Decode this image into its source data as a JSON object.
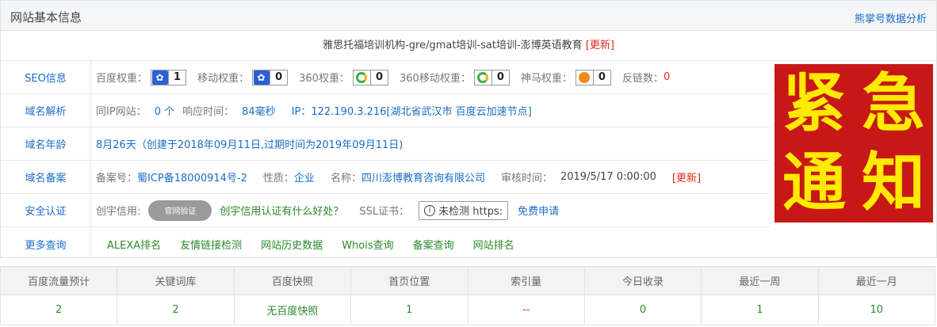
{
  "header": {
    "title": "网站基本信息",
    "link": "熊掌号数据分析"
  },
  "site": {
    "name": "雅思托福培训机构-gre/gmat培训-sat培训-澎博英语教育",
    "update": "[更新]"
  },
  "seo": {
    "label": "SEO信息",
    "baidu_label": "百度权重：",
    "baidu_value": "1",
    "mobile_label": "移动权重：",
    "mobile_value": "0",
    "s360_label": "360权重：",
    "s360_value": "0",
    "s360m_label": "360移动权重：",
    "s360m_value": "0",
    "shenma_label": "神马权重：",
    "shenma_value": "0",
    "backlink_label": "反链数：",
    "backlink_value": "0"
  },
  "dns": {
    "label": "域名解析",
    "sameip_label": "同IP网站：",
    "sameip_value": "0 个",
    "resp_label": "响应时间：",
    "resp_value": "84毫秒",
    "ip_label": "IP：",
    "ip_value": "122.190.3.216[湖北省武汉市 百度云加速节点]"
  },
  "age": {
    "label": "域名年龄",
    "value": "8月26天（创建于2018年09月11日,过期时间为2019年09月11日)"
  },
  "icp": {
    "label": "域名备案",
    "no_label": "备案号：",
    "no_value": "蜀ICP备18000914号-2",
    "type_label": "性质：",
    "type_value": "企业",
    "name_label": "名称：",
    "name_value": "四川澎博教育咨询有限公司",
    "time_label": "审核时间：",
    "time_value": "2019/5/17 0:00:00",
    "update": "[更新]"
  },
  "security": {
    "label": "安全认证",
    "credit_label": "创宇信用:",
    "seal_text": "官网验证",
    "credit_link": "创宇信用认证有什么好处？",
    "ssl_label": "SSL证书：",
    "ssl_value": "未检测 https:",
    "apply": "免费申请"
  },
  "more": {
    "label": "更多查询",
    "links": [
      "ALEXA排名",
      "友情链接检测",
      "网站历史数据",
      "Whois查询",
      "备案查询",
      "网站排名"
    ]
  },
  "banner": {
    "chars": [
      "紧",
      "急",
      "通",
      "知"
    ]
  },
  "stats": {
    "headers": [
      "百度流量预计",
      "关键词库",
      "百度快照",
      "首页位置",
      "索引量",
      "今日收录",
      "最近一周",
      "最近一月"
    ],
    "values": [
      "2",
      "2",
      "无百度快照",
      "1",
      "--",
      "0",
      "1",
      "10"
    ]
  },
  "colors": {
    "accent": "#1a6cc8",
    "link_green": "#2a8a2a",
    "alert_red": "#e0281b",
    "banner_bg": "#c81717",
    "banner_text": "#ffea00"
  }
}
